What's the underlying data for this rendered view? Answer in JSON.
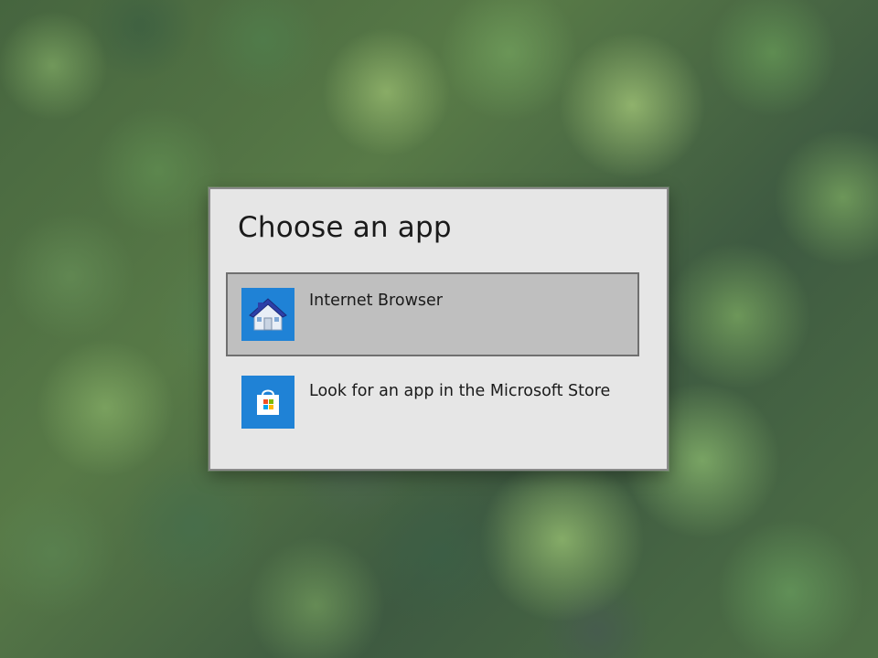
{
  "dialog": {
    "title": "Choose an app",
    "options": [
      {
        "label": "Internet Browser",
        "icon": "house-icon",
        "selected": true
      },
      {
        "label": "Look for an app in the Microsoft Store",
        "icon": "microsoft-store-icon",
        "selected": false
      }
    ]
  },
  "colors": {
    "dialog_background": "#e6e6e6",
    "selected_background": "#bfbfbf",
    "selected_border": "#6f6f6f",
    "icon_tile": "#1f82d6"
  }
}
